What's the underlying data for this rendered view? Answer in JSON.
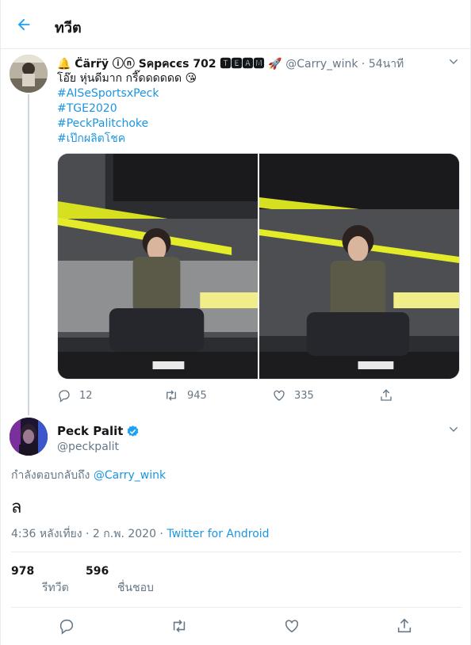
{
  "header": {
    "title": "ทวีต",
    "back_icon": "arrow-left-icon",
    "accent": "#1da1f2"
  },
  "parent_tweet": {
    "display_name": "🔔 C̈ärr̈ÿ ⓘⓝ Sคpคcєs 702 🆃🅴🅰🅼 🚀",
    "handle": "@Carry_wink",
    "separator": "·",
    "time": "54นาที",
    "text": "โอ๊ย หุ่นดีมาก กรี๊ดดดดดด 😘",
    "hashtags": [
      "#AISeSportsxPeck",
      "#TGE2020",
      "#PeckPalitchoke",
      "#เป๊กผลิตโชค"
    ],
    "actions": {
      "replies": "12",
      "retweets": "945",
      "likes": "335"
    }
  },
  "main_tweet": {
    "display_name": "Peck Palit",
    "handle": "@peckpalit",
    "verified": true,
    "reply_prefix": "กำลังตอบกลับถึง",
    "reply_handle": "@Carry_wink",
    "text": "ล",
    "timestamp": "4:36 หลังเที่ยง · 2 ก.พ. 2020 ·",
    "source": "Twitter for Android",
    "retweet_count": "978",
    "retweet_label": "รีทวีต",
    "like_count": "596",
    "like_label": "ชื่นชอบ"
  },
  "colors": {
    "link": "#1b95e0",
    "muted": "#657786",
    "divider": "#e6ecf0"
  }
}
